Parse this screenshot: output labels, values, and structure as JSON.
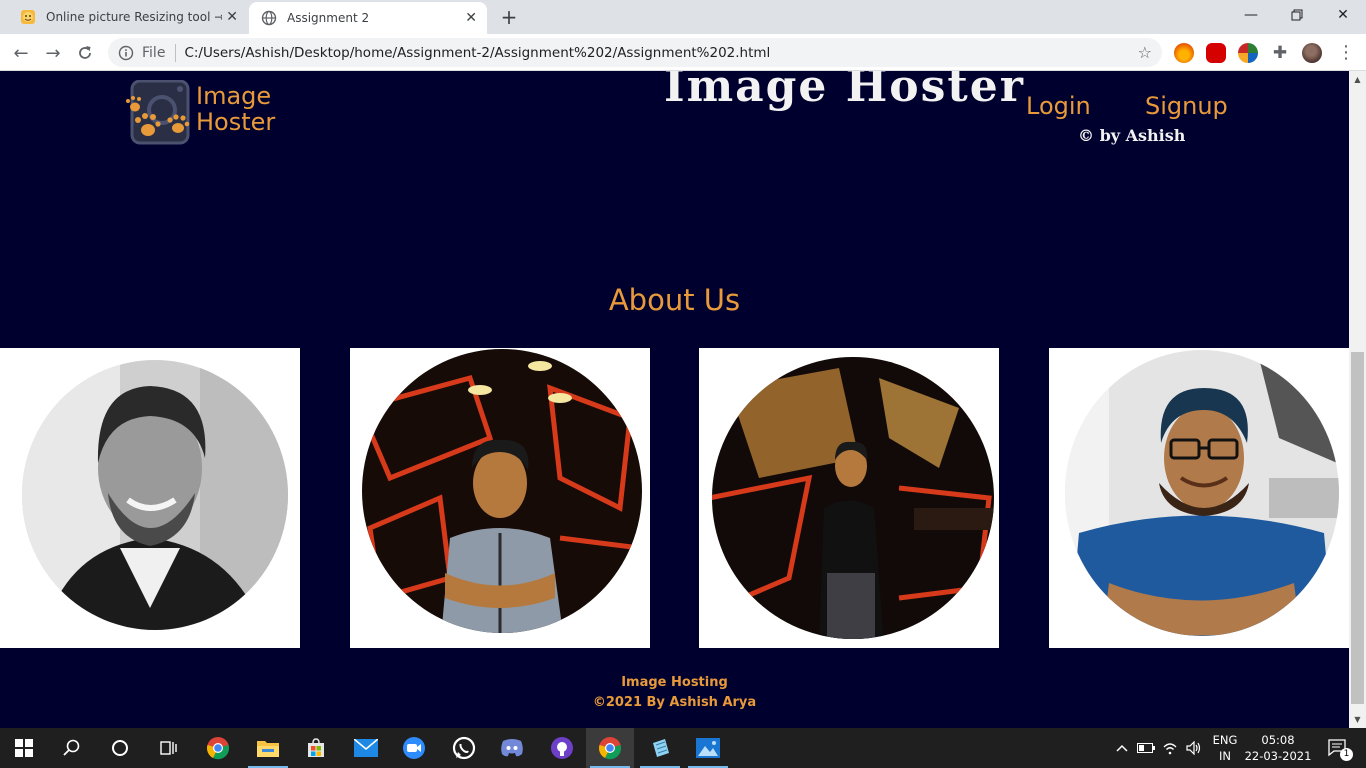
{
  "browser": {
    "tabs": [
      {
        "title": "Online picture Resizing tool → Co",
        "active": false
      },
      {
        "title": "Assignment 2",
        "active": true
      }
    ],
    "omnibox": {
      "scheme": "File",
      "url": "C:/Users/Ashish/Desktop/home/Assignment-2/Assignment%202/Assignment%202.html"
    }
  },
  "page": {
    "logo_text_line1": "Image",
    "logo_text_line2": "Hoster",
    "site_title": "Image Hoster",
    "site_credit": "© by Ashish",
    "nav": {
      "login": "Login",
      "signup": "Signup"
    },
    "about_heading": "About Us",
    "people": [
      {
        "icon": "person-photo-bw-suit"
      },
      {
        "icon": "person-photo-neon-grey-shirt"
      },
      {
        "icon": "person-photo-neon-black-shirt"
      },
      {
        "icon": "person-photo-blue-shirt-glasses"
      }
    ],
    "footer": {
      "line1": "Image Hosting",
      "line2": "©2021 By Ashish Arya"
    },
    "colors": {
      "background": "#00002e",
      "accent": "#e89a3a",
      "title": "#f2f2f2"
    }
  },
  "taskbar": {
    "language_line1": "ENG",
    "language_line2": "IN",
    "time": "05:08",
    "date": "22-03-2021",
    "notification_count": "1"
  }
}
